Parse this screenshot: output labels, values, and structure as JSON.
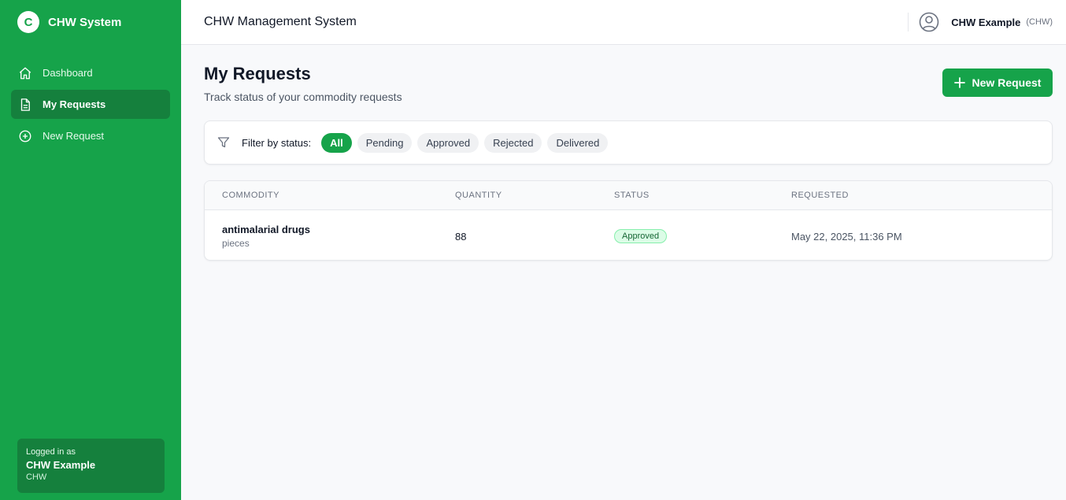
{
  "sidebar": {
    "brand_initial": "C",
    "brand_name": "CHW System",
    "items": [
      {
        "label": "Dashboard",
        "icon": "home-icon"
      },
      {
        "label": "My Requests",
        "icon": "document-icon",
        "active": true
      },
      {
        "label": "New Request",
        "icon": "plus-circle-icon"
      }
    ],
    "user_card": {
      "label": "Logged in as",
      "name": "CHW Example",
      "role": "CHW"
    }
  },
  "header": {
    "title": "CHW Management System",
    "user_name": "CHW Example",
    "user_role": "(CHW)",
    "user_icon": "user-circle-icon"
  },
  "page": {
    "title": "My Requests",
    "subtitle": "Track status of your commodity requests",
    "new_button": "New Request"
  },
  "filter": {
    "label": "Filter by status:",
    "icon": "funnel-icon",
    "options": [
      "All",
      "Pending",
      "Approved",
      "Rejected",
      "Delivered"
    ],
    "selected": "All"
  },
  "table": {
    "headers": {
      "commodity": "Commodity",
      "quantity": "Quantity",
      "status": "Status",
      "requested": "Requested"
    },
    "rows": [
      {
        "commodity": "antimalarial drugs",
        "unit": "pieces",
        "quantity": "88",
        "status": "Approved",
        "requested": "May 22, 2025, 11:36 PM"
      }
    ]
  },
  "colors": {
    "primary": "#16a34a",
    "primary_dark": "#15803d",
    "approved_bg": "#dcfce7",
    "approved_text": "#166534"
  }
}
